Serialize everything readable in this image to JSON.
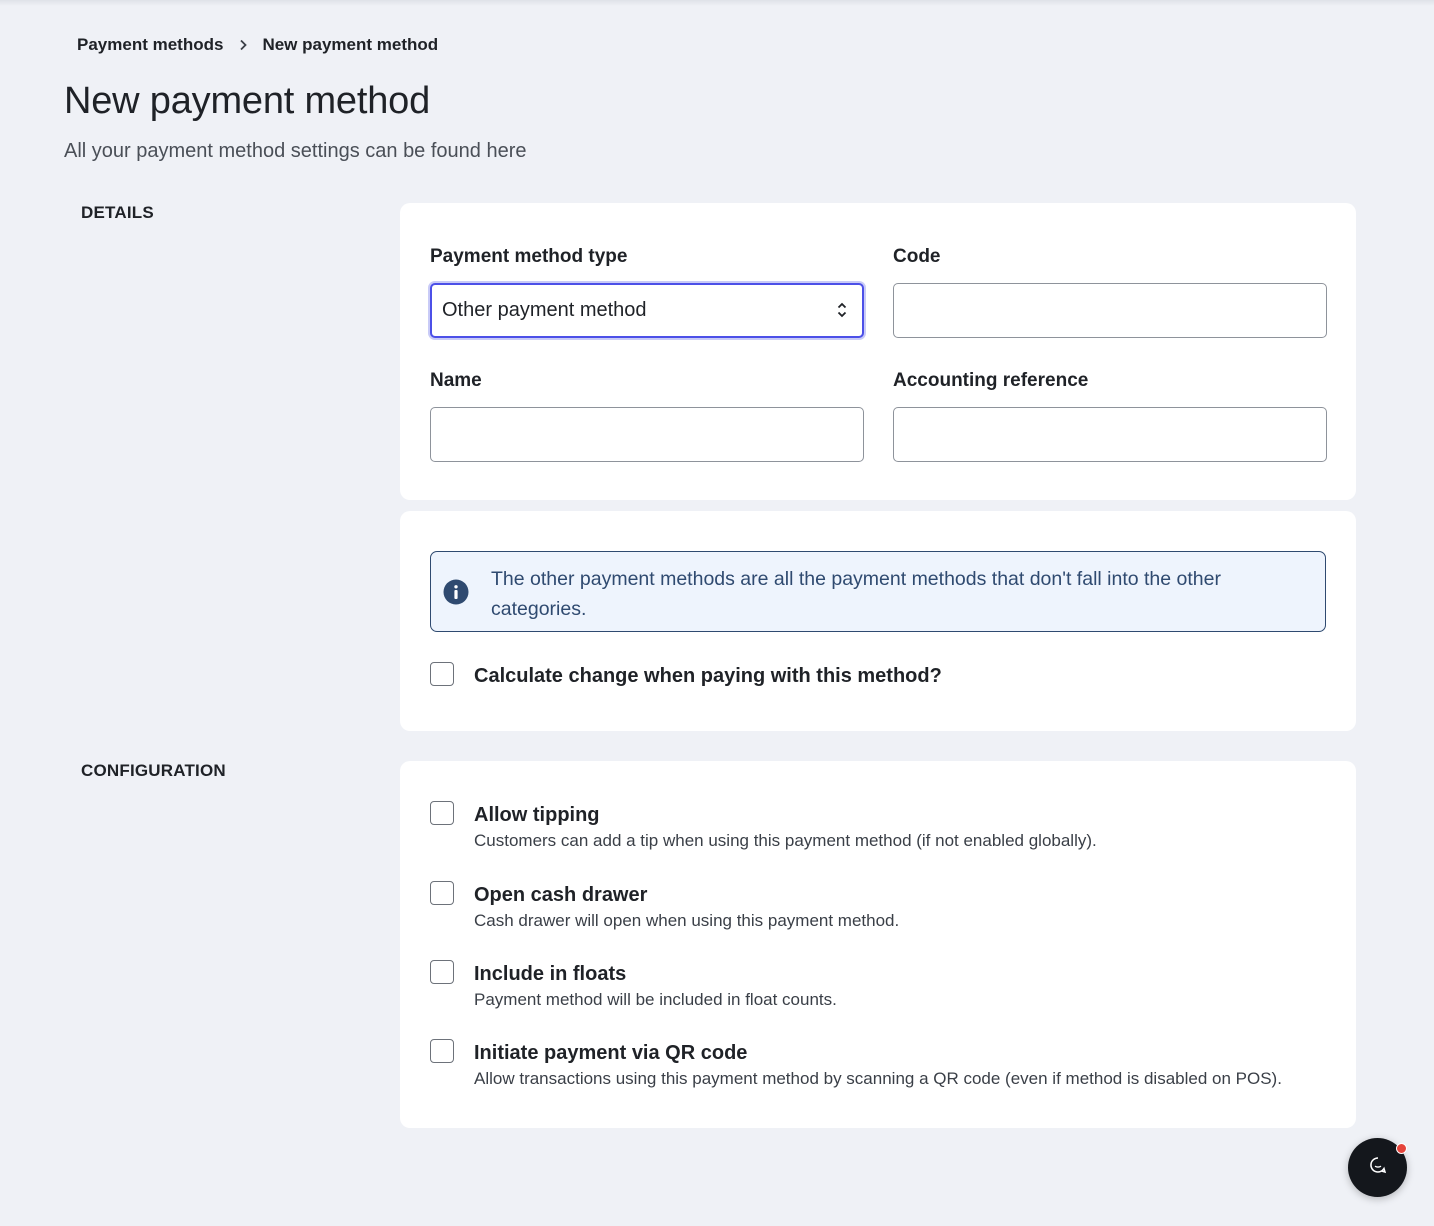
{
  "breadcrumb": {
    "parent": "Payment methods",
    "current": "New payment method"
  },
  "header": {
    "title": "New payment method",
    "subtitle": "All your payment method settings can be found here"
  },
  "sections": {
    "details": "DETAILS",
    "configuration": "CONFIGURATION"
  },
  "form": {
    "type_label": "Payment method type",
    "type_value": "Other payment method",
    "code_label": "Code",
    "code_value": "",
    "name_label": "Name",
    "name_value": "",
    "accounting_label": "Accounting reference",
    "accounting_value": ""
  },
  "info": {
    "text": "The other payment methods are all the payment methods that don't fall into the other categories."
  },
  "calculate_change": {
    "label": "Calculate change when paying with this method?",
    "checked": false
  },
  "configuration": {
    "items": [
      {
        "label": "Allow tipping",
        "description": "Customers can add a tip when using this payment method (if not enabled globally).",
        "checked": false
      },
      {
        "label": "Open cash drawer",
        "description": "Cash drawer will open when using this payment method.",
        "checked": false
      },
      {
        "label": "Include in floats",
        "description": "Payment method will be included in float counts.",
        "checked": false
      },
      {
        "label": "Initiate payment via QR code",
        "description": "Allow transactions using this payment method by scanning a QR code (even if method is disabled on POS).",
        "checked": false
      }
    ]
  },
  "colors": {
    "background": "#eff1f6",
    "accent": "#4c50e8",
    "info_text": "#2f4a70",
    "chat_button": "#14171c",
    "notification_dot": "#e5443b"
  },
  "icons": {
    "breadcrumb_separator": "chevron-right-icon",
    "select": "chevron-up-down-icon",
    "info": "info-icon",
    "chat": "chat-icon"
  }
}
